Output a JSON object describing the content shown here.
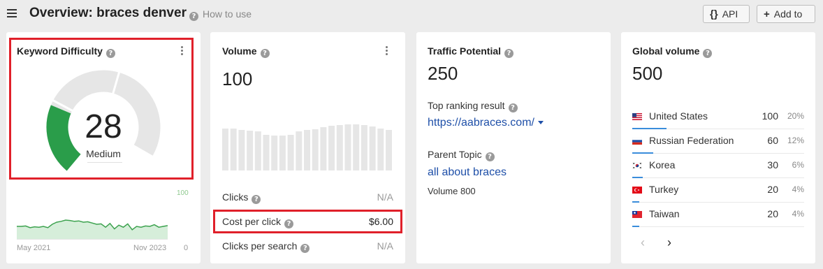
{
  "header": {
    "title": "Overview: braces denver",
    "how_to_use": "How to use",
    "api_label": "API",
    "api_glyph": "{}",
    "add_to_label": "Add to",
    "add_glyph": "+"
  },
  "keyword_difficulty": {
    "title": "Keyword Difficulty",
    "value": "28",
    "level": "Medium",
    "score_fraction": 0.28,
    "colors": {
      "low": "#2a9d4a",
      "gauge_bg": "#e6e6e6",
      "highlight": "#e0202a"
    },
    "trend": {
      "y_max_label": "100",
      "y_min_label": "0",
      "start_label": "May 2021",
      "end_label": "Nov 2023",
      "values": [
        30,
        30,
        31,
        27,
        29,
        28,
        30,
        27,
        35,
        40,
        42,
        45,
        44,
        42,
        43,
        40,
        41,
        38,
        35,
        36,
        28,
        37,
        24,
        33,
        28,
        36,
        22,
        30,
        28,
        31,
        30,
        34,
        28,
        30,
        32
      ]
    }
  },
  "volume": {
    "title": "Volume",
    "value": "100",
    "bars": [
      60,
      60,
      58,
      57,
      56,
      51,
      50,
      50,
      51,
      56,
      58,
      59,
      62,
      64,
      65,
      66,
      66,
      65,
      63,
      60,
      58
    ],
    "clicks_label": "Clicks",
    "clicks_value": "N/A",
    "cpc_label": "Cost per click",
    "cpc_value": "$6.00",
    "cps_label": "Clicks per search",
    "cps_value": "N/A"
  },
  "traffic_potential": {
    "title": "Traffic Potential",
    "value": "250",
    "top_result_label": "Top ranking result",
    "top_result_url": "https://aabraces.com/",
    "parent_topic_label": "Parent Topic",
    "parent_topic": "all about braces",
    "parent_volume": "Volume 800"
  },
  "global_volume": {
    "title": "Global volume",
    "value": "500",
    "countries": [
      {
        "name": "United States",
        "volume": "100",
        "percent": "20%",
        "share": 0.2,
        "flag": "us-flag-icon"
      },
      {
        "name": "Russian Federation",
        "volume": "60",
        "percent": "12%",
        "share": 0.12,
        "flag": "ru-flag-icon"
      },
      {
        "name": "Korea",
        "volume": "30",
        "percent": "6%",
        "share": 0.06,
        "flag": "kr-flag-icon"
      },
      {
        "name": "Turkey",
        "volume": "20",
        "percent": "4%",
        "share": 0.04,
        "flag": "tr-flag-icon"
      },
      {
        "name": "Taiwan",
        "volume": "20",
        "percent": "4%",
        "share": 0.04,
        "flag": "tw-flag-icon"
      }
    ],
    "prev_glyph": "‹",
    "next_glyph": "›"
  }
}
